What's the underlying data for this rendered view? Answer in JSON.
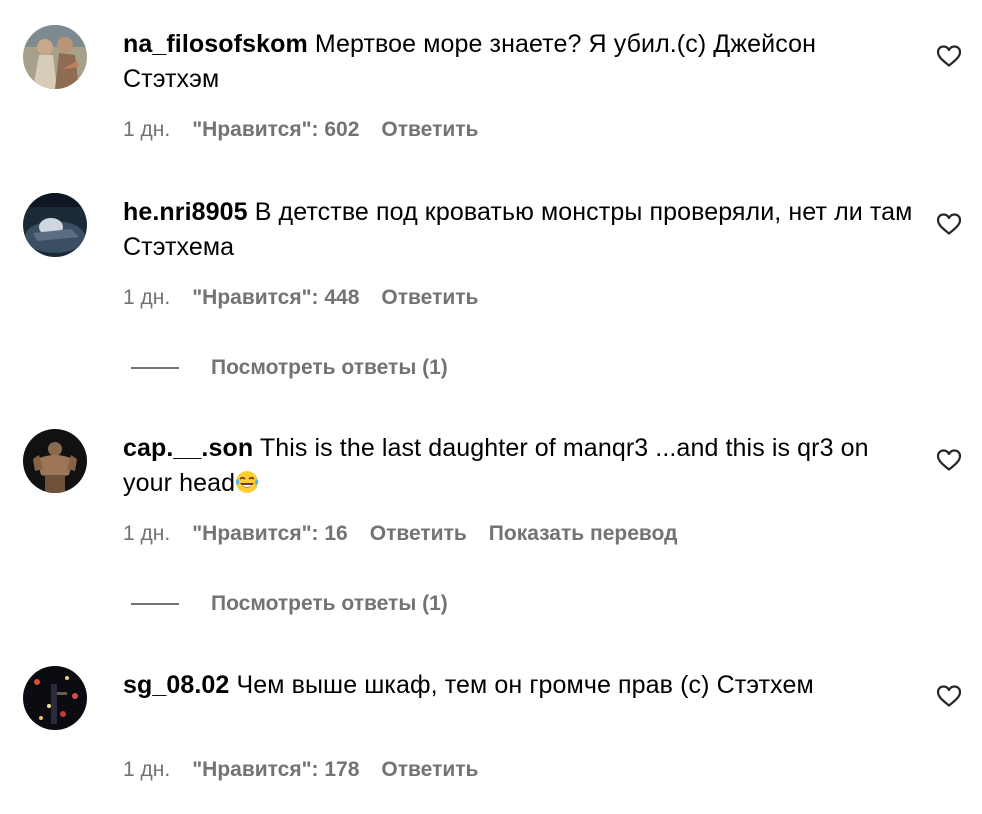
{
  "comments": [
    {
      "username": "na_filosofskom",
      "text": " Мертвое море знаете? Я убил.(с) Джейсон Стэтхэм",
      "time": "1 дн.",
      "likes": "\"Нравится\": 602",
      "reply": "Ответить"
    },
    {
      "username": "he.nri8905",
      "text": " В детстве под кроватью монстры проверяли, нет ли там Стэтхема",
      "time": "1 дн.",
      "likes": "\"Нравится\": 448",
      "reply": "Ответить",
      "view_replies": "Посмотреть ответы (1)"
    },
    {
      "username": "cap.__.son",
      "text": " This is the last daughter of manqr3 ...and this is qr3 on your head",
      "emoji": "face-with-tears-of-joy",
      "time": "1 дн.",
      "likes": "\"Нравится\": 16",
      "reply": "Ответить",
      "translate": "Показать перевод",
      "view_replies": "Посмотреть ответы (1)"
    },
    {
      "username": "sg_08.02",
      "text": " Чем выше шкаф, тем он громче прав (с) Стэтхем",
      "time": "1 дн.",
      "likes": "\"Нравится\": 178",
      "reply": "Ответить"
    }
  ],
  "icons": {
    "like": "heart-outline-icon"
  },
  "colors": {
    "text": "#000000",
    "secondary": "#737373",
    "background": "#ffffff"
  }
}
